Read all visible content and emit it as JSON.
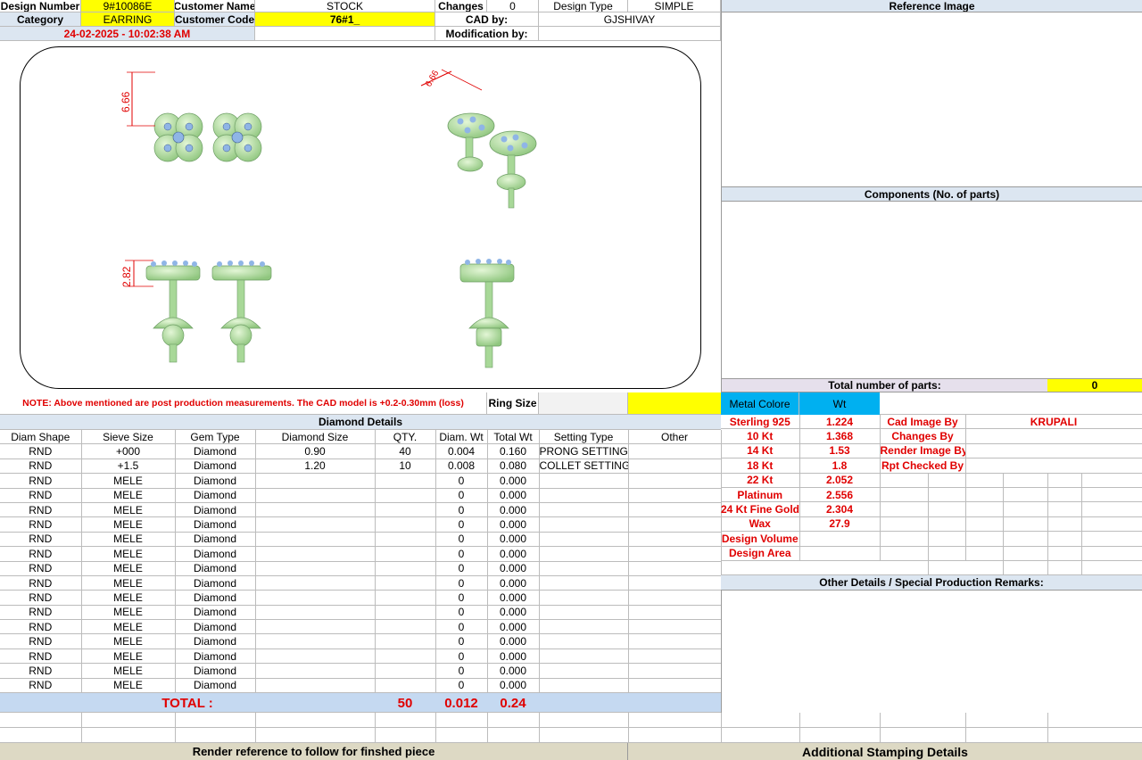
{
  "header": {
    "design_number_label": "Design Number",
    "design_number": "9#10086E",
    "customer_name_label": "Customer Name",
    "customer_name": "STOCK",
    "changes_label": "Changes",
    "changes": "0",
    "design_type_label": "Design Type",
    "design_type": "SIMPLE",
    "category_label": "Category",
    "category": "EARRING",
    "customer_code_label": "Customer Code",
    "customer_code": "76#1_",
    "cad_by_label": "CAD by:",
    "cad_by": "GJSHIVAY",
    "timestamp": "24-02-2025 - 10:02:38 AM",
    "modification_by_label": "Modification by:"
  },
  "right_panel": {
    "reference_image_label": "Reference Image",
    "components_label": "Components (No. of parts)",
    "total_parts_label": "Total number of parts:",
    "total_parts": "0",
    "other_details_label": "Other Details / Special Production Remarks:"
  },
  "drawing": {
    "dim_top": "6.66",
    "dim_iso": "6.66",
    "dim_side": "2.82"
  },
  "note": "NOTE: Above mentioned are post production measurements. The CAD model is +0.2-0.30mm (loss)",
  "ring_size_label": "Ring Size",
  "diamond": {
    "title": "Diamond Details",
    "columns": [
      "Diam Shape",
      "Sieve Size",
      "Gem Type",
      "Diamond Size",
      "QTY.",
      "Diam. Wt",
      "Total Wt",
      "Setting Type",
      "Other"
    ],
    "rows": [
      [
        "RND",
        "+000",
        "Diamond",
        "0.90",
        "40",
        "0.004",
        "0.160",
        "PRONG SETTING",
        ""
      ],
      [
        "RND",
        "+1.5",
        "Diamond",
        "1.20",
        "10",
        "0.008",
        "0.080",
        "COLLET SETTING",
        ""
      ],
      [
        "RND",
        "MELE",
        "Diamond",
        "",
        "",
        "0",
        "0.000",
        "",
        ""
      ],
      [
        "RND",
        "MELE",
        "Diamond",
        "",
        "",
        "0",
        "0.000",
        "",
        ""
      ],
      [
        "RND",
        "MELE",
        "Diamond",
        "",
        "",
        "0",
        "0.000",
        "",
        ""
      ],
      [
        "RND",
        "MELE",
        "Diamond",
        "",
        "",
        "0",
        "0.000",
        "",
        ""
      ],
      [
        "RND",
        "MELE",
        "Diamond",
        "",
        "",
        "0",
        "0.000",
        "",
        ""
      ],
      [
        "RND",
        "MELE",
        "Diamond",
        "",
        "",
        "0",
        "0.000",
        "",
        ""
      ],
      [
        "RND",
        "MELE",
        "Diamond",
        "",
        "",
        "0",
        "0.000",
        "",
        ""
      ],
      [
        "RND",
        "MELE",
        "Diamond",
        "",
        "",
        "0",
        "0.000",
        "",
        ""
      ],
      [
        "RND",
        "MELE",
        "Diamond",
        "",
        "",
        "0",
        "0.000",
        "",
        ""
      ],
      [
        "RND",
        "MELE",
        "Diamond",
        "",
        "",
        "0",
        "0.000",
        "",
        ""
      ],
      [
        "RND",
        "MELE",
        "Diamond",
        "",
        "",
        "0",
        "0.000",
        "",
        ""
      ],
      [
        "RND",
        "MELE",
        "Diamond",
        "",
        "",
        "0",
        "0.000",
        "",
        ""
      ],
      [
        "RND",
        "MELE",
        "Diamond",
        "",
        "",
        "0",
        "0.000",
        "",
        ""
      ],
      [
        "RND",
        "MELE",
        "Diamond",
        "",
        "",
        "0",
        "0.000",
        "",
        ""
      ],
      [
        "RND",
        "MELE",
        "Diamond",
        "",
        "",
        "0",
        "0.000",
        "",
        ""
      ]
    ],
    "total_label": "TOTAL :",
    "total_qty": "50",
    "total_diam_wt": "0.012",
    "total_wt": "0.24"
  },
  "metal": {
    "color_label": "Metal Colore",
    "wt_label": "Wt",
    "rows": [
      {
        "name": "Sterling 925",
        "wt": "1.224",
        "role": "Cad Image By",
        "person": "KRUPALI"
      },
      {
        "name": "10 Kt",
        "wt": "1.368",
        "role": "Changes By",
        "person": ""
      },
      {
        "name": "14 Kt",
        "wt": "1.53",
        "role": "Render Image By",
        "person": ""
      },
      {
        "name": "18 Kt",
        "wt": "1.8",
        "role": "Rpt Checked By",
        "person": ""
      },
      {
        "name": "22 Kt",
        "wt": "2.052",
        "role": "",
        "person": ""
      },
      {
        "name": "Platinum",
        "wt": "2.556",
        "role": "",
        "person": ""
      },
      {
        "name": "24 Kt Fine Gold",
        "wt": "2.304",
        "role": "",
        "person": ""
      },
      {
        "name": "Wax",
        "wt": "27.9",
        "role": "",
        "person": ""
      },
      {
        "name": "Design Volume",
        "wt": "",
        "role": "",
        "person": ""
      },
      {
        "name": "Design Area",
        "wt": "",
        "role": "",
        "person": ""
      }
    ]
  },
  "footer": {
    "render_ref": "Render reference to follow for finshed piece",
    "stamping": "Additional Stamping Details"
  },
  "colors": {
    "yellow": "#ffff00",
    "label_blue": "#dce6f1",
    "total_blue": "#c5d9f1",
    "metal_header": "#00b0f0",
    "red_text": "#e00000",
    "metal_green": "#b9e3a6",
    "stone_blue": "#8fb5e6",
    "footer_tan": "#ddd9c4"
  }
}
